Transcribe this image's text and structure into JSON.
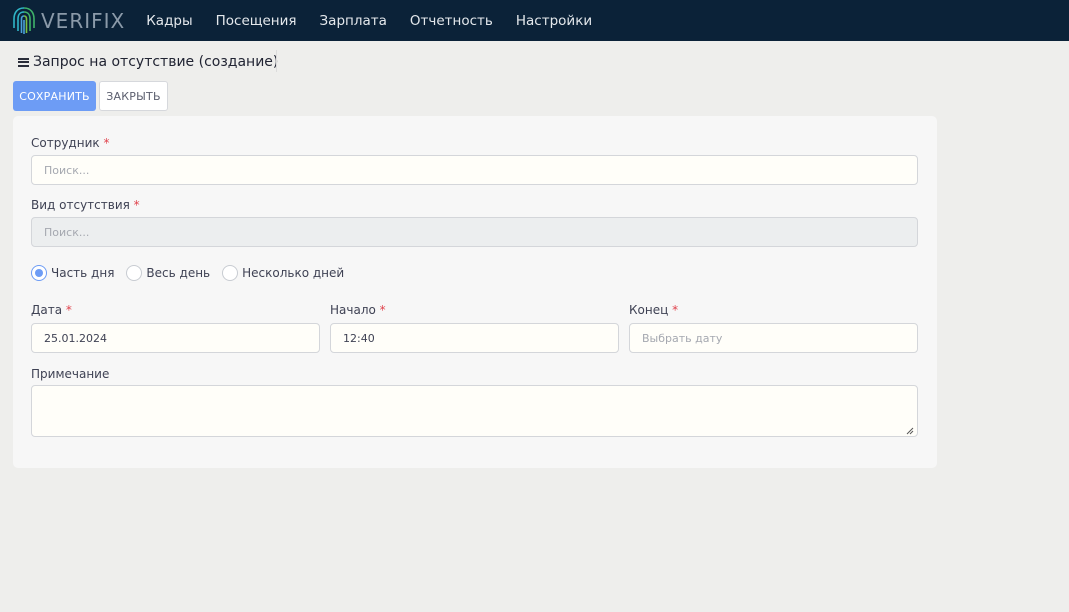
{
  "app": {
    "logo_text": "VERIFIX",
    "nav": [
      "Кадры",
      "Посещения",
      "Зарплата",
      "Отчетность",
      "Настройки"
    ]
  },
  "page": {
    "title": "Запрос на отсутствие (создание)"
  },
  "toolbar": {
    "save_label": "СОХРАНИТЬ",
    "close_label": "ЗАКРЫТЬ"
  },
  "form": {
    "required_mark": "*",
    "employee": {
      "label": "Сотрудник",
      "placeholder": "Поиск...",
      "value": ""
    },
    "absence_type": {
      "label": "Вид отсутствия",
      "placeholder": "Поиск...",
      "value": "",
      "disabled": true
    },
    "duration_options": [
      {
        "label": "Часть дня",
        "checked": true
      },
      {
        "label": "Весь день",
        "checked": false
      },
      {
        "label": "Несколько дней",
        "checked": false
      }
    ],
    "date": {
      "label": "Дата",
      "value": "25.01.2024"
    },
    "start": {
      "label": "Начало",
      "value": "12:40"
    },
    "end": {
      "label": "Конец",
      "placeholder": "Выбрать дату",
      "value": ""
    },
    "note": {
      "label": "Примечание",
      "value": ""
    }
  },
  "colors": {
    "topbar": "#0b2238",
    "accent": "#6d9cf5",
    "required": "#e0424c"
  }
}
